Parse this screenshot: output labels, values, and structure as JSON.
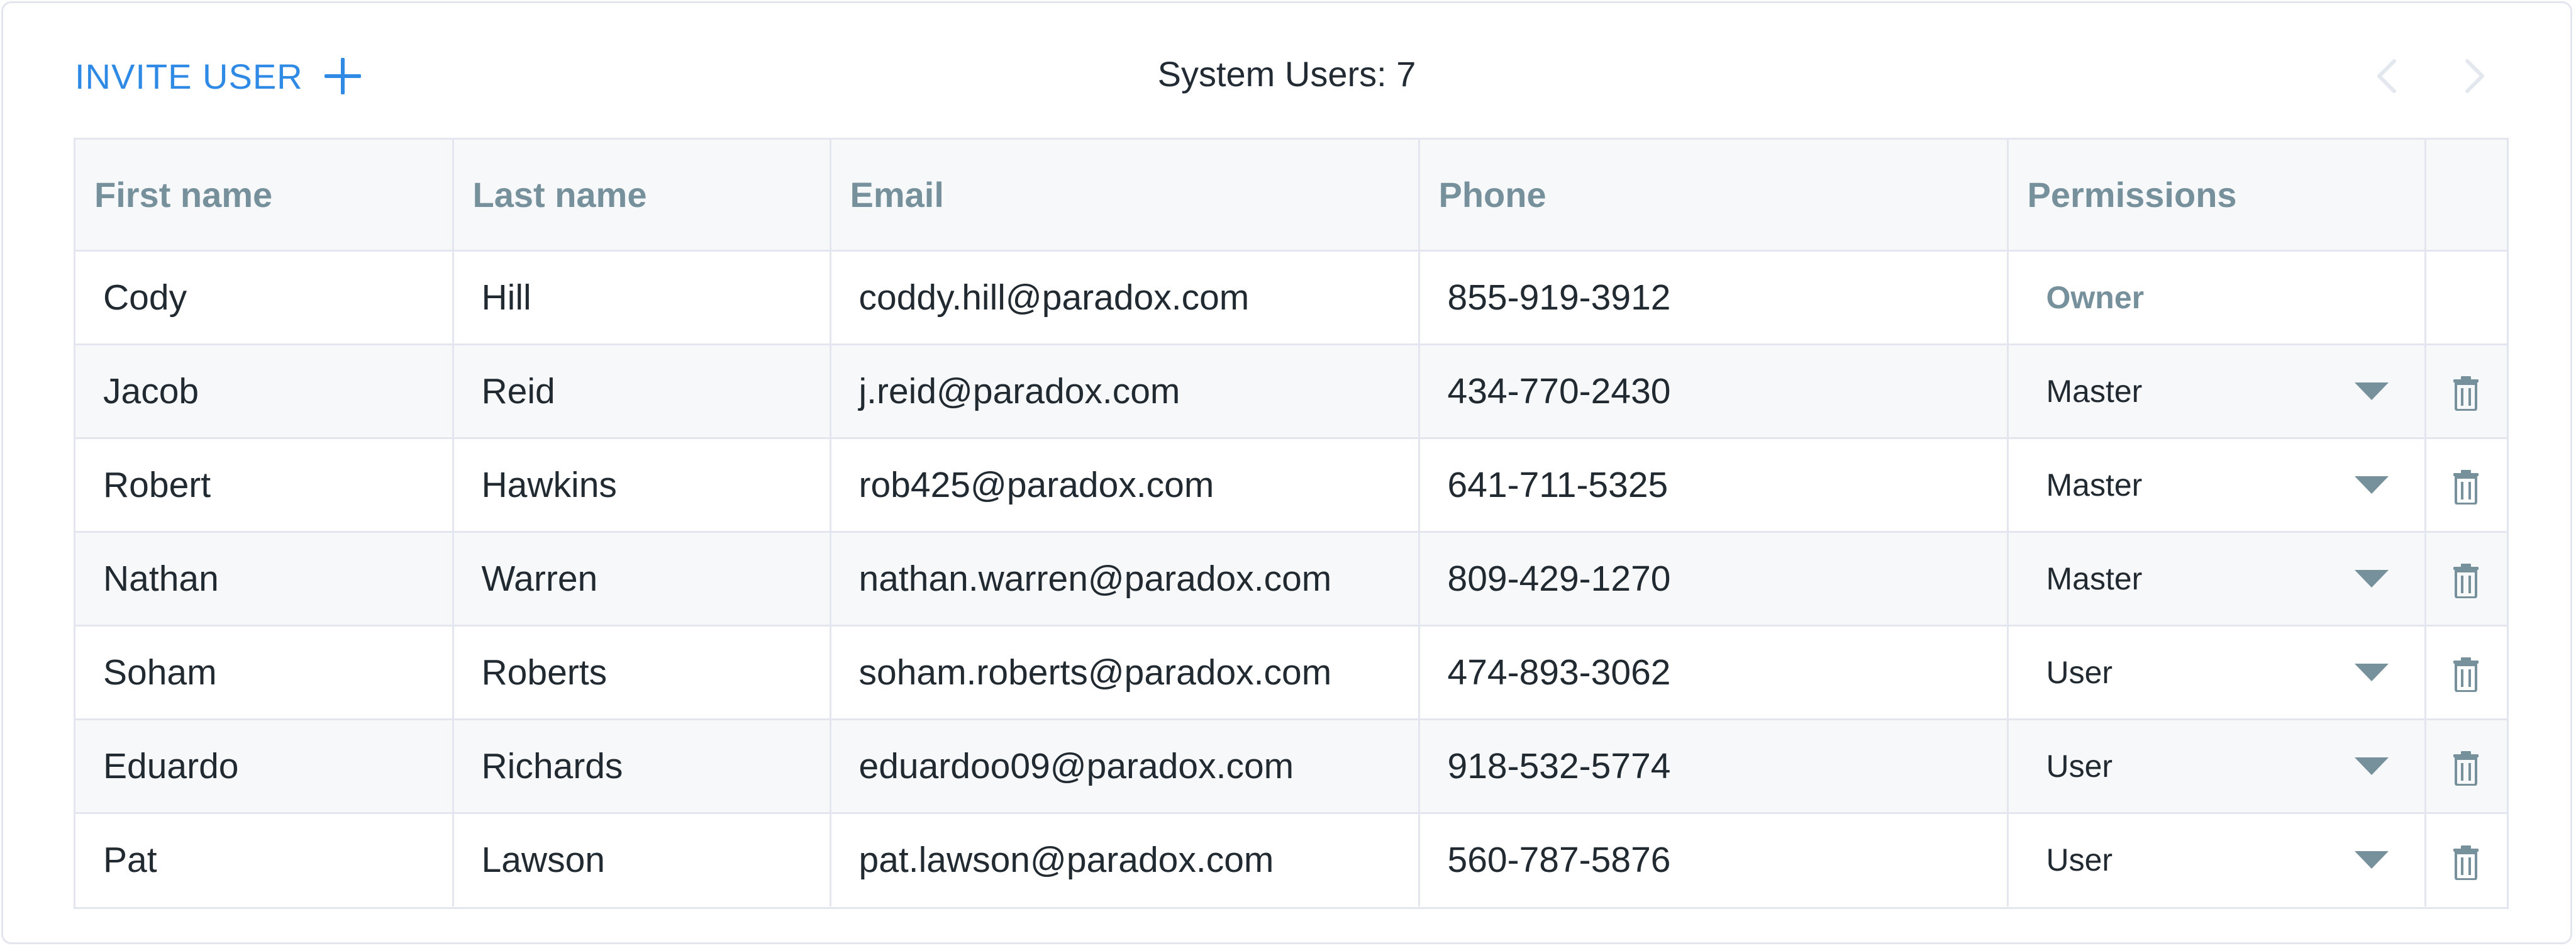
{
  "header": {
    "invite_label": "INVITE USER",
    "title": "System Users: 7"
  },
  "colors": {
    "accent": "#2f8ae6",
    "header_text": "#76909c",
    "border": "#e3e6ee",
    "row_alt": "#f7f8fa"
  },
  "icons": {
    "invite": "plus-icon",
    "prev": "chevron-left-icon",
    "next": "chevron-right-icon",
    "dropdown": "caret-down-icon",
    "delete": "trash-icon"
  },
  "table": {
    "columns": [
      "First name",
      "Last name",
      "Email",
      "Phone",
      "Permissions",
      ""
    ],
    "rows": [
      {
        "first": "Cody",
        "last": "Hill",
        "email": "coddy.hill@paradox.com",
        "phone": "855-919-3912",
        "permission": "Owner"
      },
      {
        "first": "Jacob",
        "last": "Reid",
        "email": "j.reid@paradox.com",
        "phone": "434-770-2430",
        "permission": "Master"
      },
      {
        "first": "Robert",
        "last": "Hawkins",
        "email": "rob425@paradox.com",
        "phone": "641-711-5325",
        "permission": "Master"
      },
      {
        "first": "Nathan",
        "last": "Warren",
        "email": "nathan.warren@paradox.com",
        "phone": "809-429-1270",
        "permission": "Master"
      },
      {
        "first": "Soham",
        "last": "Roberts",
        "email": "soham.roberts@paradox.com",
        "phone": "474-893-3062",
        "permission": "User"
      },
      {
        "first": "Eduardo",
        "last": "Richards",
        "email": "eduardoo09@paradox.com",
        "phone": "918-532-5774",
        "permission": "User"
      },
      {
        "first": "Pat",
        "last": "Lawson",
        "email": "pat.lawson@paradox.com",
        "phone": "560-787-5876",
        "permission": "User"
      }
    ]
  }
}
